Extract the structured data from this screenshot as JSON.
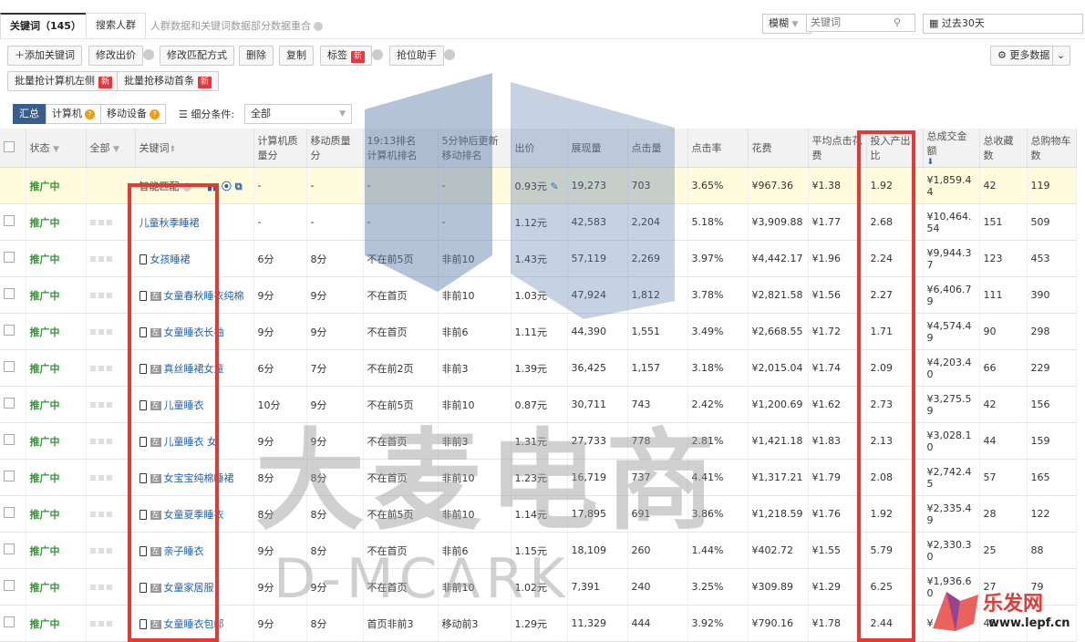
{
  "tabs": {
    "keywords": "关键词（145）",
    "crowd": "搜索人群",
    "info": "人群数据和关键词数据部分数据重合"
  },
  "search": {
    "mode": "模糊",
    "placeholder": "关键词",
    "date": "过去30天"
  },
  "toolbar": {
    "add": "添加关键词",
    "bid": "修改出价",
    "match": "修改匹配方式",
    "delete": "删除",
    "copy": "复制",
    "tag": "标签",
    "rank": "抢位助手",
    "more": "更多数据",
    "batch_pc": "批量抢计算机左侧",
    "batch_mobile": "批量抢移动首条",
    "new": "新"
  },
  "filter": {
    "all": "汇总",
    "pc": "计算机",
    "mobile": "移动设备",
    "label": "细分条件:",
    "value": "全部"
  },
  "headers": {
    "status": "状态",
    "all": "全部",
    "keyword": "关键词",
    "pc_q": "计算机质量分",
    "mob_q": "移动质量分",
    "time": "19:13排名",
    "update": "5分钟后更新",
    "pc_rank": "计算机排名",
    "mob_rank": "移动排名",
    "bid": "出价",
    "impr": "展现量",
    "clicks": "点击量",
    "ctr": "点击率",
    "cost": "花费",
    "cpc": "平均点击花费",
    "roi": "投入产出比",
    "gmv": "总成交金额",
    "fav": "总收藏数",
    "cart": "总购物车数"
  },
  "rows": [
    {
      "status": "推广中",
      "kw": "智能匹配",
      "pcq": "-",
      "mq": "-",
      "pr": "-",
      "mr": "-",
      "bid": "0.93元",
      "impr": "19,273",
      "clicks": "703",
      "ctr": "3.65%",
      "cost": "¥967.36",
      "cpc": "¥1.38",
      "roi": "1.92",
      "gmv": "¥1,859.44",
      "fav": "42",
      "cart": "119"
    },
    {
      "status": "推广中",
      "kw": "儿童秋季睡裙",
      "pcq": "-",
      "mq": "-",
      "pr": "-",
      "mr": "-",
      "bid": "1.12元",
      "impr": "42,583",
      "clicks": "2,204",
      "ctr": "5.18%",
      "cost": "¥3,909.88",
      "cpc": "¥1.77",
      "roi": "2.68",
      "gmv": "¥10,464.54",
      "fav": "151",
      "cart": "509"
    },
    {
      "status": "推广中",
      "kw": "女孩睡裙",
      "pcq": "6分",
      "mq": "8分",
      "pr": "不在前5页",
      "mr": "非前10",
      "bid": "1.43元",
      "impr": "57,119",
      "clicks": "2,269",
      "ctr": "3.97%",
      "cost": "¥4,442.17",
      "cpc": "¥1.96",
      "roi": "2.24",
      "gmv": "¥9,944.37",
      "fav": "123",
      "cart": "453"
    },
    {
      "status": "推广中",
      "kw": "女童春秋睡衣纯棉",
      "pcq": "9分",
      "mq": "9分",
      "pr": "不在首页",
      "mr": "非前10",
      "bid": "1.03元",
      "impr": "47,924",
      "clicks": "1,812",
      "ctr": "3.78%",
      "cost": "¥2,821.58",
      "cpc": "¥1.56",
      "roi": "2.27",
      "gmv": "¥6,406.79",
      "fav": "111",
      "cart": "390"
    },
    {
      "status": "推广中",
      "kw": "女童睡衣长袖",
      "pcq": "9分",
      "mq": "9分",
      "pr": "不在首页",
      "mr": "非前6",
      "bid": "1.11元",
      "impr": "44,390",
      "clicks": "1,551",
      "ctr": "3.49%",
      "cost": "¥2,668.55",
      "cpc": "¥1.72",
      "roi": "1.71",
      "gmv": "¥4,574.49",
      "fav": "90",
      "cart": "298"
    },
    {
      "status": "推广中",
      "kw": "真丝睡裙女童",
      "pcq": "6分",
      "mq": "7分",
      "pr": "不在前2页",
      "mr": "非前3",
      "bid": "1.39元",
      "impr": "36,425",
      "clicks": "1,157",
      "ctr": "3.18%",
      "cost": "¥2,015.04",
      "cpc": "¥1.74",
      "roi": "2.09",
      "gmv": "¥4,203.40",
      "fav": "66",
      "cart": "229"
    },
    {
      "status": "推广中",
      "kw": "儿童睡衣",
      "pcq": "10分",
      "mq": "9分",
      "pr": "不在前5页",
      "mr": "非前10",
      "bid": "0.87元",
      "impr": "30,711",
      "clicks": "743",
      "ctr": "2.42%",
      "cost": "¥1,200.69",
      "cpc": "¥1.62",
      "roi": "2.73",
      "gmv": "¥3,275.59",
      "fav": "42",
      "cart": "156"
    },
    {
      "status": "推广中",
      "kw": "儿童睡衣 女",
      "pcq": "9分",
      "mq": "9分",
      "pr": "不在首页",
      "mr": "非前3",
      "bid": "1.31元",
      "impr": "27,733",
      "clicks": "778",
      "ctr": "2.81%",
      "cost": "¥1,421.18",
      "cpc": "¥1.83",
      "roi": "2.13",
      "gmv": "¥3,028.10",
      "fav": "44",
      "cart": "159"
    },
    {
      "status": "推广中",
      "kw": "女宝宝纯棉睡裙",
      "pcq": "8分",
      "mq": "8分",
      "pr": "不在首页",
      "mr": "非前10",
      "bid": "1.23元",
      "impr": "16,719",
      "clicks": "737",
      "ctr": "4.41%",
      "cost": "¥1,317.21",
      "cpc": "¥1.79",
      "roi": "2.08",
      "gmv": "¥2,742.45",
      "fav": "57",
      "cart": "165"
    },
    {
      "status": "推广中",
      "kw": "女童夏季睡衣",
      "pcq": "8分",
      "mq": "8分",
      "pr": "不在前5页",
      "mr": "非前10",
      "bid": "1.14元",
      "impr": "17,895",
      "clicks": "691",
      "ctr": "3.86%",
      "cost": "¥1,218.59",
      "cpc": "¥1.76",
      "roi": "1.92",
      "gmv": "¥2,335.49",
      "fav": "28",
      "cart": "122"
    },
    {
      "status": "推广中",
      "kw": "亲子睡衣",
      "pcq": "9分",
      "mq": "8分",
      "pr": "不在首页",
      "mr": "非前6",
      "bid": "1.15元",
      "impr": "18,109",
      "clicks": "260",
      "ctr": "1.44%",
      "cost": "¥402.72",
      "cpc": "¥1.55",
      "roi": "5.79",
      "gmv": "¥2,330.30",
      "fav": "25",
      "cart": "88"
    },
    {
      "status": "推广中",
      "kw": "女童家居服",
      "pcq": "9分",
      "mq": "9分",
      "pr": "不在首页",
      "mr": "非前10",
      "bid": "1.02元",
      "impr": "7,391",
      "clicks": "240",
      "ctr": "3.25%",
      "cost": "¥309.89",
      "cpc": "¥1.29",
      "roi": "6.25",
      "gmv": "¥1,936.60",
      "fav": "27",
      "cart": "79"
    },
    {
      "status": "推广中",
      "kw": "女童睡衣包邮",
      "pcq": "9分",
      "mq": "8分",
      "pr": "首页非前3",
      "mr": "移动前3",
      "bid": "1.29元",
      "impr": "11,329",
      "clicks": "444",
      "ctr": "3.92%",
      "cost": "¥790.16",
      "cpc": "¥1.78",
      "roi": "2.44",
      "gmv": "¥",
      "fav": "45",
      "cart": ""
    }
  ],
  "watermark": {
    "cn": "大麦电商",
    "en": "D-MCARK",
    "logo_cn": "乐发网",
    "logo_url": "www.lepf.cn"
  }
}
